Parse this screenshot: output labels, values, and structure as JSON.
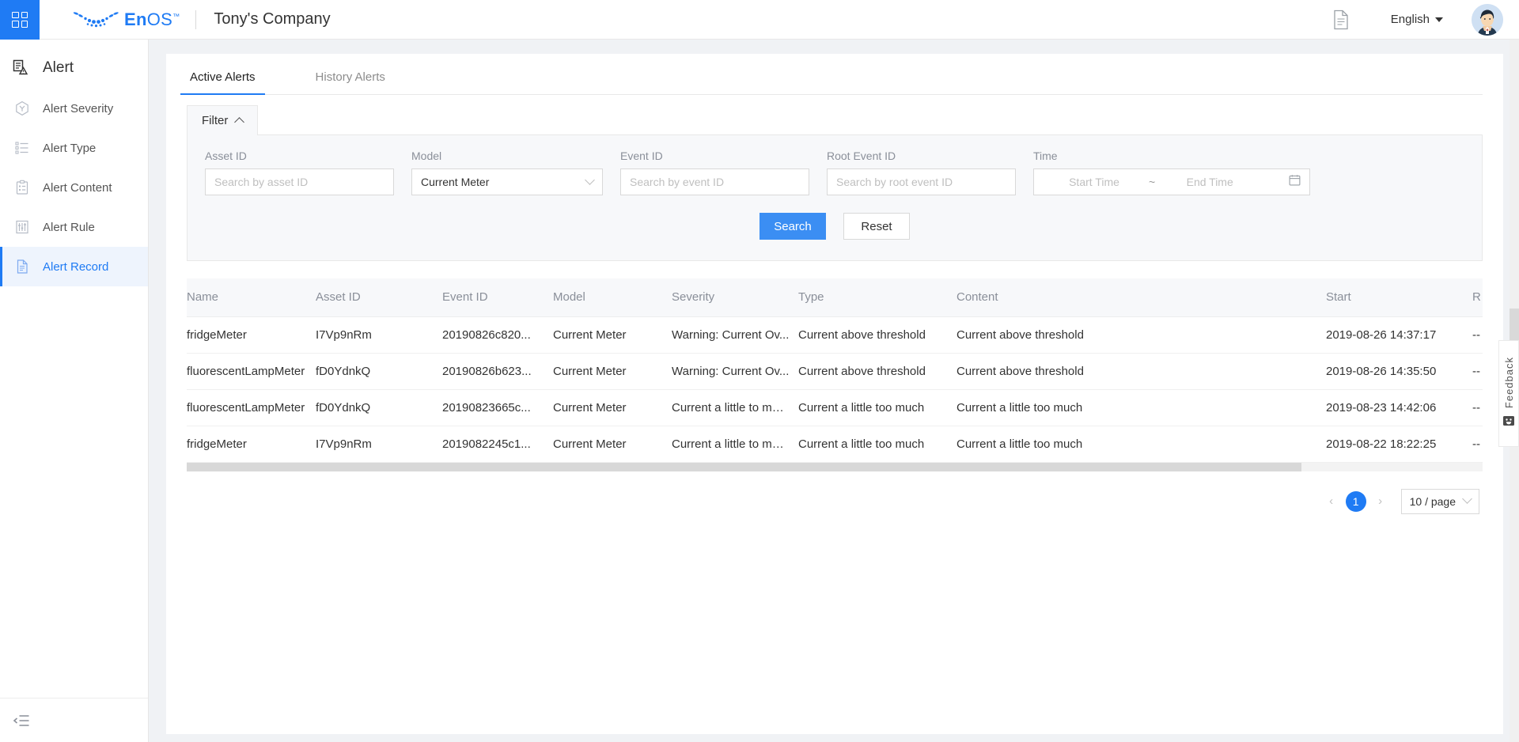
{
  "topbar": {
    "apps_icon": "apps-grid-icon",
    "brand_en": "En",
    "brand_os": "OS",
    "brand_tm": "™",
    "company": "Tony's Company",
    "doc_icon": "document-icon",
    "language": "English",
    "avatar_icon": "user-avatar"
  },
  "sidebar": {
    "title": "Alert",
    "title_icon": "alert-document-icon",
    "items": [
      {
        "label": "Alert Severity",
        "icon": "severity-hexagon-icon",
        "active": false
      },
      {
        "label": "Alert Type",
        "icon": "list-icon",
        "active": false
      },
      {
        "label": "Alert Content",
        "icon": "clipboard-icon",
        "active": false
      },
      {
        "label": "Alert Rule",
        "icon": "sliders-icon",
        "active": false
      },
      {
        "label": "Alert Record",
        "icon": "file-icon",
        "active": true
      }
    ],
    "collapse_icon": "menu-fold-icon"
  },
  "tabs": [
    {
      "label": "Active Alerts",
      "active": true
    },
    {
      "label": "History Alerts",
      "active": false
    }
  ],
  "filter": {
    "title": "Filter",
    "collapse_icon": "chevron-up-icon",
    "fields": {
      "asset_id": {
        "label": "Asset ID",
        "placeholder": "Search by asset ID",
        "value": ""
      },
      "model": {
        "label": "Model",
        "value": "Current Meter",
        "caret_icon": "chevron-down-icon"
      },
      "event_id": {
        "label": "Event ID",
        "placeholder": "Search by event ID",
        "value": ""
      },
      "root_event_id": {
        "label": "Root Event ID",
        "placeholder": "Search by root event ID",
        "value": ""
      },
      "time": {
        "label": "Time",
        "start_placeholder": "Start Time",
        "separator": "~",
        "end_placeholder": "End Time",
        "calendar_icon": "calendar-icon"
      }
    },
    "search_button": "Search",
    "reset_button": "Reset"
  },
  "table": {
    "columns": [
      "Name",
      "Asset ID",
      "Event ID",
      "Model",
      "Severity",
      "Type",
      "Content",
      "Start",
      "R"
    ],
    "rows": [
      {
        "name": "fridgeMeter",
        "asset_id": "I7Vp9nRm",
        "event_id": "20190826c820...",
        "model": "Current Meter",
        "severity": "Warning: Current Ov...",
        "type": "Current above threshold",
        "content": "Current above threshold",
        "start": "2019-08-26 14:37:17",
        "r": "--"
      },
      {
        "name": "fluorescentLampMeter",
        "asset_id": "fD0YdnkQ",
        "event_id": "20190826b623...",
        "model": "Current Meter",
        "severity": "Warning: Current Ov...",
        "type": "Current above threshold",
        "content": "Current above threshold",
        "start": "2019-08-26 14:35:50",
        "r": "--"
      },
      {
        "name": "fluorescentLampMeter",
        "asset_id": "fD0YdnkQ",
        "event_id": "20190823665c...",
        "model": "Current Meter",
        "severity": "Current a little to much",
        "type": "Current a little too much",
        "content": "Current a little too much",
        "start": "2019-08-23 14:42:06",
        "r": "--"
      },
      {
        "name": "fridgeMeter",
        "asset_id": "I7Vp9nRm",
        "event_id": "2019082245c1...",
        "model": "Current Meter",
        "severity": "Current a little to much",
        "type": "Current a little too much",
        "content": "Current a little too much",
        "start": "2019-08-22 18:22:25",
        "r": "--"
      }
    ]
  },
  "pagination": {
    "prev_icon": "chevron-left-icon",
    "current_page": "1",
    "next_icon": "chevron-right-icon",
    "page_size": "10 / page",
    "page_size_caret": "chevron-down-icon"
  },
  "feedback": {
    "label": "Feedback",
    "icon": "smiley-icon"
  },
  "colors": {
    "accent": "#1f7bf4",
    "primary_button": "#3b8ef3",
    "panel_bg": "#f7f8fa",
    "page_bg": "#f0f2f5"
  }
}
